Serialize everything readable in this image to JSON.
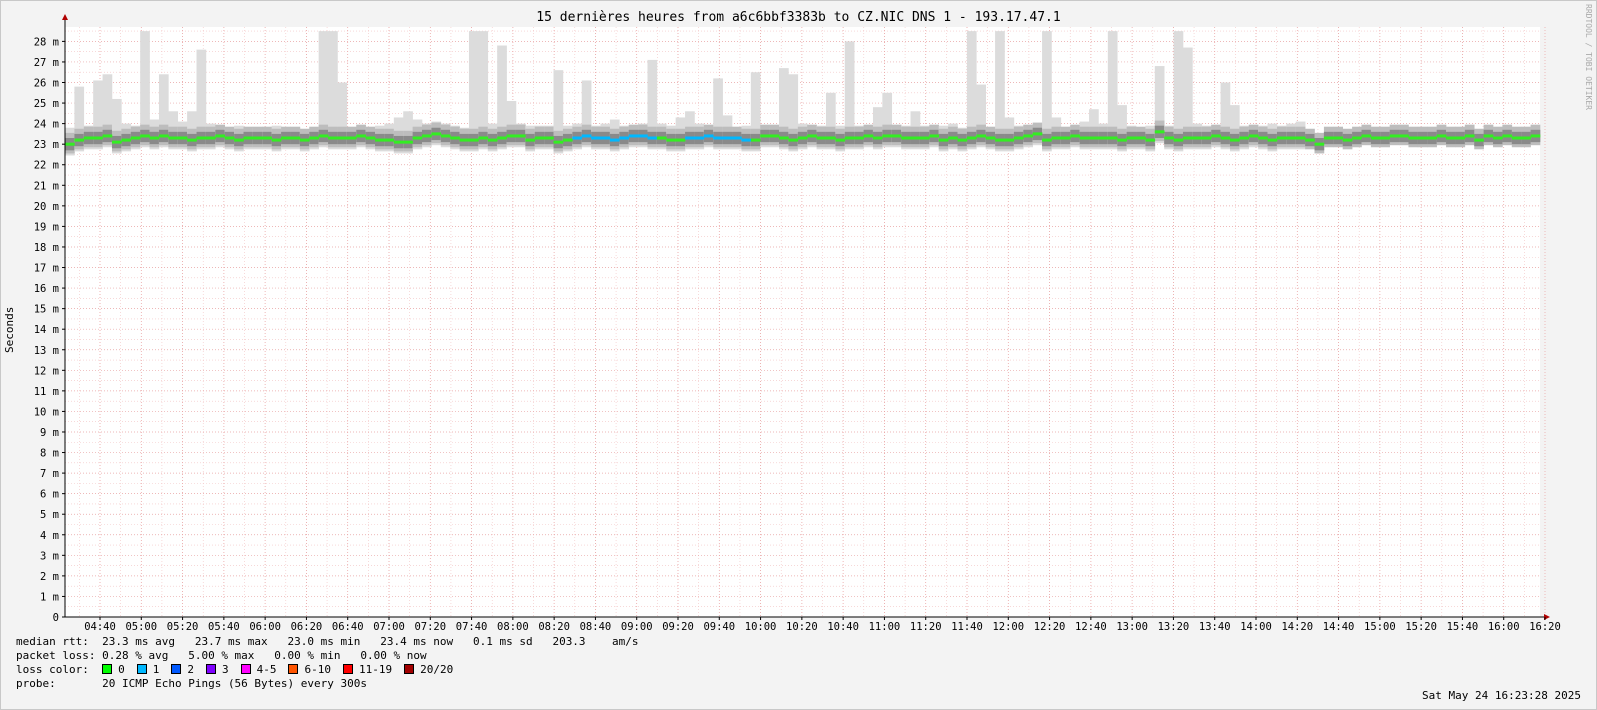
{
  "title": "15 dernières heures from a6c6bbf3383b to CZ.NIC DNS 1 - 193.17.47.1",
  "watermark": "RRDTOOL / TOBI OETIKER",
  "chart_data": {
    "type": "area",
    "title": "15 dernières heures from a6c6bbf3383b to CZ.NIC DNS 1 - 193.17.47.1",
    "ylabel": "Seconds",
    "xlabel": "",
    "ylim": [
      0,
      28.7
    ],
    "y_unit": "m",
    "y_ticks": [
      0,
      1,
      2,
      3,
      4,
      5,
      6,
      7,
      8,
      9,
      10,
      11,
      12,
      13,
      14,
      15,
      16,
      17,
      18,
      19,
      20,
      21,
      22,
      23,
      24,
      25,
      26,
      27,
      28
    ],
    "y_tick_labels": [
      "0",
      "1 m",
      "2 m",
      "3 m",
      "4 m",
      "5 m",
      "6 m",
      "7 m",
      "8 m",
      "9 m",
      "10 m",
      "11 m",
      "12 m",
      "13 m",
      "14 m",
      "15 m",
      "16 m",
      "17 m",
      "18 m",
      "19 m",
      "20 m",
      "21 m",
      "22 m",
      "23 m",
      "24 m",
      "25 m",
      "26 m",
      "27 m",
      "28 m"
    ],
    "x_tick_labels": [
      "04:40",
      "05:00",
      "05:20",
      "05:40",
      "06:00",
      "06:20",
      "06:40",
      "07:00",
      "07:20",
      "07:40",
      "08:00",
      "08:20",
      "08:40",
      "09:00",
      "09:20",
      "09:40",
      "10:00",
      "10:20",
      "10:40",
      "11:00",
      "11:20",
      "11:40",
      "12:00",
      "12:20",
      "12:40",
      "13:00",
      "13:20",
      "13:40",
      "14:00",
      "14:20",
      "14:40",
      "15:00",
      "15:20",
      "15:40",
      "16:00",
      "16:20"
    ],
    "grid": true,
    "series": [
      {
        "name": "median rtt",
        "unit": "ms",
        "values": [
          23.0,
          23.2,
          23.3,
          23.3,
          23.4,
          23.1,
          23.2,
          23.3,
          23.4,
          23.3,
          23.4,
          23.3,
          23.3,
          23.2,
          23.3,
          23.3,
          23.4,
          23.3,
          23.2,
          23.3,
          23.3,
          23.3,
          23.2,
          23.3,
          23.3,
          23.2,
          23.3,
          23.4,
          23.3,
          23.3,
          23.3,
          23.4,
          23.3,
          23.2,
          23.2,
          23.1,
          23.1,
          23.3,
          23.4,
          23.5,
          23.4,
          23.3,
          23.2,
          23.2,
          23.3,
          23.2,
          23.3,
          23.4,
          23.4,
          23.2,
          23.3,
          23.3,
          23.1,
          23.2,
          23.3,
          23.4,
          23.3,
          23.3,
          23.2,
          23.3,
          23.4,
          23.4,
          23.3,
          23.3,
          23.2,
          23.2,
          23.3,
          23.3,
          23.4,
          23.3,
          23.3,
          23.3,
          23.2,
          23.2,
          23.4,
          23.4,
          23.3,
          23.2,
          23.3,
          23.4,
          23.3,
          23.3,
          23.2,
          23.3,
          23.3,
          23.4,
          23.3,
          23.4,
          23.4,
          23.3,
          23.3,
          23.3,
          23.4,
          23.2,
          23.3,
          23.2,
          23.3,
          23.4,
          23.3,
          23.2,
          23.2,
          23.3,
          23.4,
          23.5,
          23.2,
          23.3,
          23.3,
          23.4,
          23.3,
          23.3,
          23.3,
          23.3,
          23.2,
          23.3,
          23.3,
          23.2,
          23.6,
          23.3,
          23.2,
          23.3,
          23.3,
          23.3,
          23.4,
          23.3,
          23.2,
          23.3,
          23.4,
          23.3,
          23.2,
          23.3,
          23.3,
          23.3,
          23.2,
          23.0,
          23.3,
          23.3,
          23.2,
          23.3,
          23.4,
          23.3,
          23.3,
          23.4,
          23.4,
          23.3,
          23.3,
          23.3,
          23.4,
          23.3,
          23.3,
          23.4,
          23.2,
          23.4,
          23.3,
          23.4,
          23.3,
          23.3,
          23.4
        ]
      },
      {
        "name": "max spikes",
        "unit": "ms",
        "values": [
          23.8,
          25.8,
          23.9,
          26.1,
          26.4,
          25.2,
          24.0,
          23.9,
          28.5,
          24.2,
          26.4,
          24.6,
          24.1,
          24.6,
          27.6,
          24.0,
          23.8,
          23.8,
          23.9,
          23.8,
          23.8,
          23.7,
          23.9,
          23.8,
          23.8,
          23.7,
          23.7,
          28.5,
          28.5,
          26.0,
          23.8,
          23.7,
          23.8,
          23.9,
          24.0,
          24.3,
          24.6,
          24.2,
          24.0,
          24.1,
          24.0,
          23.9,
          23.8,
          28.5,
          28.5,
          24.0,
          27.8,
          25.1,
          24.0,
          23.9,
          23.9,
          23.9,
          26.6,
          23.9,
          24.0,
          26.1,
          23.9,
          24.0,
          24.2,
          23.9,
          23.9,
          24.0,
          27.1,
          24.0,
          23.9,
          24.3,
          24.6,
          24.0,
          23.9,
          26.2,
          24.4,
          23.8,
          23.9,
          26.5,
          23.9,
          23.8,
          26.7,
          26.4,
          24.0,
          23.8,
          23.9,
          25.5,
          23.9,
          28.0,
          23.9,
          23.8,
          24.8,
          25.5,
          23.8,
          23.9,
          24.6,
          23.9,
          23.8,
          23.9,
          24.0,
          23.8,
          28.5,
          25.9,
          23.8,
          28.5,
          24.3,
          23.9,
          23.9,
          23.8,
          28.5,
          24.3,
          23.8,
          23.9,
          24.1,
          24.7,
          24.0,
          28.5,
          24.9,
          23.9,
          23.8,
          23.9,
          26.8,
          23.9,
          28.5,
          27.7,
          24.0,
          23.9,
          23.8,
          26.0,
          24.9,
          23.9,
          23.8,
          23.9,
          24.0,
          23.9,
          24.0,
          24.1
        ]
      }
    ]
  },
  "legend": {
    "median_rtt": {
      "label": "median rtt:",
      "text": "23.3 ms avg   23.7 ms max   23.0 ms min   23.4 ms now   0.1 ms sd   203.3    am/s"
    },
    "packet_loss": {
      "label": "packet loss:",
      "text": "0.28 % avg   5.00 % max   0.00 % min   0.00 % now"
    },
    "loss_color": {
      "label": "loss color:",
      "items": [
        {
          "label": "0",
          "color": "#00ff00"
        },
        {
          "label": "1",
          "color": "#00b8ff"
        },
        {
          "label": "2",
          "color": "#0059ff"
        },
        {
          "label": "3",
          "color": "#7e00ff"
        },
        {
          "label": "4-5",
          "color": "#ff00ff"
        },
        {
          "label": "6-10",
          "color": "#ff5500"
        },
        {
          "label": "11-19",
          "color": "#ff0000"
        },
        {
          "label": "20/20",
          "color": "#a10000"
        }
      ]
    },
    "probe": {
      "label": "probe:",
      "text": "20 ICMP Echo Pings (56 Bytes) every 300s"
    }
  },
  "timestamp": "Sat May 24 16:23:28 2025"
}
